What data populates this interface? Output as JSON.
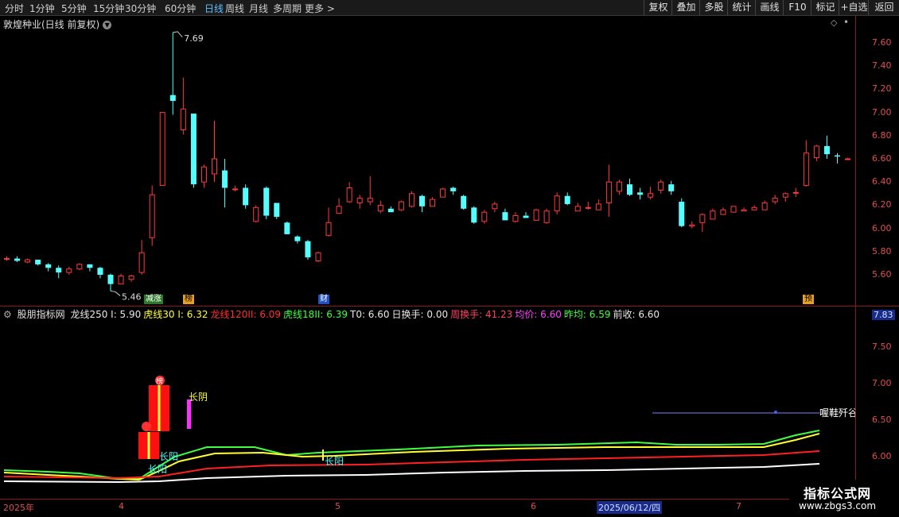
{
  "toolbar": {
    "timeframes": [
      "分时",
      "1分钟",
      "5分钟",
      "15分钟",
      "30分钟",
      "60分钟",
      "日线",
      "周线",
      "月线",
      "多周期",
      "更多 >"
    ],
    "active_timeframe": "日线",
    "right_buttons": [
      "复权",
      "叠加",
      "多股",
      "统计",
      "画线",
      "F10",
      "标记",
      "+自选",
      "返回"
    ]
  },
  "stock": {
    "title": "敦煌种业(日线 前复权)",
    "dropdown_icon": "chevron-down-icon"
  },
  "price_panel": {
    "y_ticks": [
      "7.60",
      "7.40",
      "7.20",
      "7.00",
      "6.80",
      "6.60",
      "6.40",
      "6.20",
      "6.00",
      "5.80",
      "5.60"
    ],
    "high_label": "7.69",
    "low_label": "5.46",
    "event_markers": [
      "减涨",
      "榜",
      "财",
      "预"
    ],
    "colors": {
      "up": "#ff3a3a",
      "down": "#54ffff",
      "tick": "#e05050"
    }
  },
  "indicator": {
    "name": "股朋指标网",
    "items": [
      {
        "label": "龙线250 I",
        "value": "5.90",
        "color": "#e8e8e8"
      },
      {
        "label": "虎线30 I",
        "value": "6.32",
        "color": "#ffff40"
      },
      {
        "label": "龙线120II",
        "value": "6.09",
        "color": "#ff3030"
      },
      {
        "label": "虎线18II",
        "value": "6.39",
        "color": "#40ff40"
      },
      {
        "label": "T0",
        "value": "6.60",
        "color": "#e8e8e8"
      },
      {
        "label": "日换手",
        "value": "0.00",
        "color": "#e8e8e8"
      },
      {
        "label": "周换手",
        "value": "41.23",
        "color": "#ff4060"
      },
      {
        "label": "均价",
        "value": "6.60",
        "color": "#ff40ff"
      },
      {
        "label": "昨均",
        "value": "6.59",
        "color": "#40ff40"
      },
      {
        "label": "前收",
        "value": "6.60",
        "color": "#e8e8e8"
      }
    ],
    "y_ticks": [
      "7.83",
      "7.50",
      "7.00",
      "6.50",
      "6.00"
    ],
    "labels": {
      "changyang": "长阳",
      "changyin": "长阴",
      "bang": "榜",
      "right_text": "喔鞋歼谷"
    }
  },
  "x_axis": {
    "labels": [
      "2025年",
      "4",
      "5",
      "6",
      "7"
    ],
    "highlight": "2025/06/12/四"
  },
  "watermark": {
    "line1": "指标公式网",
    "line2": "www.zbgs3.com"
  },
  "chart_data": {
    "type": "candlestick",
    "ylim": [
      5.46,
      7.69
    ],
    "candles": [
      [
        5.74,
        5.74,
        5.76,
        5.72
      ],
      [
        5.74,
        5.72,
        5.76,
        5.71
      ],
      [
        5.71,
        5.73,
        5.74,
        5.7
      ],
      [
        5.73,
        5.69,
        5.73,
        5.68
      ],
      [
        5.69,
        5.66,
        5.7,
        5.63
      ],
      [
        5.66,
        5.62,
        5.68,
        5.57
      ],
      [
        5.62,
        5.65,
        5.67,
        5.6
      ],
      [
        5.65,
        5.69,
        5.7,
        5.64
      ],
      [
        5.69,
        5.66,
        5.69,
        5.63
      ],
      [
        5.66,
        5.6,
        5.67,
        5.57
      ],
      [
        5.6,
        5.52,
        5.61,
        5.46
      ],
      [
        5.52,
        5.59,
        5.61,
        5.52
      ],
      [
        5.56,
        5.59,
        5.6,
        5.54
      ],
      [
        5.62,
        5.79,
        5.9,
        5.6
      ],
      [
        5.92,
        6.29,
        6.37,
        5.85
      ],
      [
        6.37,
        7.0,
        7.0,
        6.37
      ],
      [
        7.15,
        7.1,
        7.69,
        6.98
      ],
      [
        6.85,
        7.03,
        7.3,
        6.81
      ],
      [
        6.99,
        6.38,
        6.98,
        6.35
      ],
      [
        6.4,
        6.53,
        6.55,
        6.35
      ],
      [
        6.47,
        6.6,
        6.93,
        6.4
      ],
      [
        6.5,
        6.35,
        6.6,
        6.18
      ],
      [
        6.34,
        6.34,
        6.37,
        6.32
      ],
      [
        6.35,
        6.2,
        6.38,
        6.17
      ],
      [
        6.06,
        6.18,
        6.2,
        6.05
      ],
      [
        6.35,
        6.11,
        6.36,
        6.08
      ],
      [
        6.22,
        6.1,
        6.22,
        6.08
      ],
      [
        6.05,
        5.95,
        6.06,
        5.95
      ],
      [
        5.93,
        5.89,
        5.94,
        5.87
      ],
      [
        5.89,
        5.75,
        5.9,
        5.73
      ],
      [
        5.72,
        5.79,
        5.8,
        5.71
      ],
      [
        5.94,
        6.05,
        6.18,
        5.93
      ],
      [
        6.13,
        6.19,
        6.26,
        6.13
      ],
      [
        6.23,
        6.35,
        6.4,
        6.22
      ],
      [
        6.22,
        6.26,
        6.29,
        6.17
      ],
      [
        6.23,
        6.26,
        6.45,
        6.2
      ],
      [
        6.15,
        6.2,
        6.24,
        6.13
      ],
      [
        6.17,
        6.14,
        6.19,
        6.14
      ],
      [
        6.16,
        6.23,
        6.24,
        6.15
      ],
      [
        6.19,
        6.3,
        6.32,
        6.18
      ],
      [
        6.28,
        6.19,
        6.29,
        6.14
      ],
      [
        6.19,
        6.25,
        6.27,
        6.19
      ],
      [
        6.27,
        6.34,
        6.35,
        6.27
      ],
      [
        6.35,
        6.32,
        6.36,
        6.29
      ],
      [
        6.28,
        6.17,
        6.29,
        6.16
      ],
      [
        6.18,
        6.05,
        6.19,
        6.04
      ],
      [
        6.06,
        6.14,
        6.16,
        6.04
      ],
      [
        6.17,
        6.21,
        6.23,
        6.14
      ],
      [
        6.14,
        6.07,
        6.17,
        6.07
      ],
      [
        6.06,
        6.11,
        6.14,
        6.05
      ],
      [
        6.11,
        6.09,
        6.14,
        6.09
      ],
      [
        6.07,
        6.16,
        6.17,
        6.07
      ],
      [
        6.05,
        6.15,
        6.17,
        6.04
      ],
      [
        6.15,
        6.28,
        6.31,
        6.12
      ],
      [
        6.28,
        6.21,
        6.31,
        6.2
      ],
      [
        6.15,
        6.19,
        6.22,
        6.15
      ],
      [
        6.18,
        6.18,
        6.23,
        6.16
      ],
      [
        6.16,
        6.21,
        6.25,
        6.16
      ],
      [
        6.22,
        6.4,
        6.55,
        6.1
      ],
      [
        6.32,
        6.4,
        6.42,
        6.29
      ],
      [
        6.38,
        6.29,
        6.43,
        6.28
      ],
      [
        6.31,
        6.29,
        6.35,
        6.25
      ],
      [
        6.27,
        6.3,
        6.36,
        6.25
      ],
      [
        6.33,
        6.4,
        6.42,
        6.3
      ],
      [
        6.38,
        6.32,
        6.41,
        6.29
      ],
      [
        6.23,
        6.02,
        6.26,
        6.01
      ],
      [
        6.02,
        6.03,
        6.06,
        6.0
      ],
      [
        6.05,
        6.12,
        6.13,
        5.97
      ],
      [
        6.08,
        6.15,
        6.17,
        6.08
      ],
      [
        6.12,
        6.16,
        6.18,
        6.13
      ],
      [
        6.14,
        6.19,
        6.19,
        6.14
      ],
      [
        6.15,
        6.16,
        6.18,
        6.15
      ],
      [
        6.16,
        6.18,
        6.2,
        6.16
      ],
      [
        6.16,
        6.22,
        6.24,
        6.16
      ],
      [
        6.23,
        6.26,
        6.29,
        6.21
      ],
      [
        6.27,
        6.3,
        6.31,
        6.23
      ],
      [
        6.31,
        6.31,
        6.35,
        6.27
      ],
      [
        6.37,
        6.65,
        6.76,
        6.36
      ],
      [
        6.61,
        6.71,
        6.72,
        6.58
      ],
      [
        6.71,
        6.64,
        6.8,
        6.6
      ],
      [
        6.63,
        6.62,
        6.65,
        6.56
      ],
      [
        6.6,
        6.6,
        6.61,
        6.59
      ]
    ]
  }
}
